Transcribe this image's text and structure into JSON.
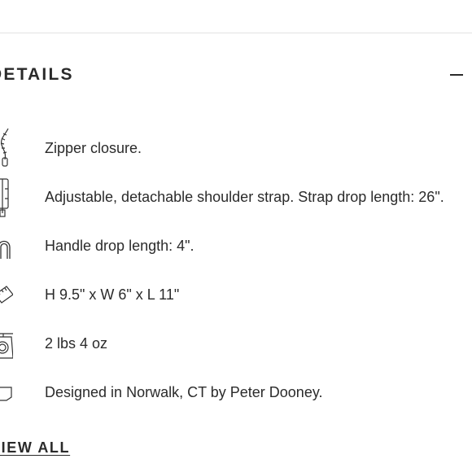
{
  "section": {
    "title": "DETAILS",
    "toggle_symbol": "minus"
  },
  "details": [
    {
      "icon": "zipper-icon",
      "text": "Zipper closure."
    },
    {
      "icon": "shoulder-strap-icon",
      "text": "Adjustable, detachable shoulder strap. Strap drop length: 26\"."
    },
    {
      "icon": "handle-icon",
      "text": "Handle drop length: 4\"."
    },
    {
      "icon": "ruler-icon",
      "text": "H 9.5\" x W 6\" x L 11\""
    },
    {
      "icon": "scale-icon",
      "text": "2 lbs 4 oz"
    },
    {
      "icon": "tag-icon",
      "text": "Designed in Norwalk, CT by Peter Dooney."
    }
  ],
  "footer": {
    "view_all_label": "VIEW ALL"
  },
  "colors": {
    "text": "#2b2b2b",
    "divider": "#e2e2e2",
    "background": "#ffffff"
  }
}
